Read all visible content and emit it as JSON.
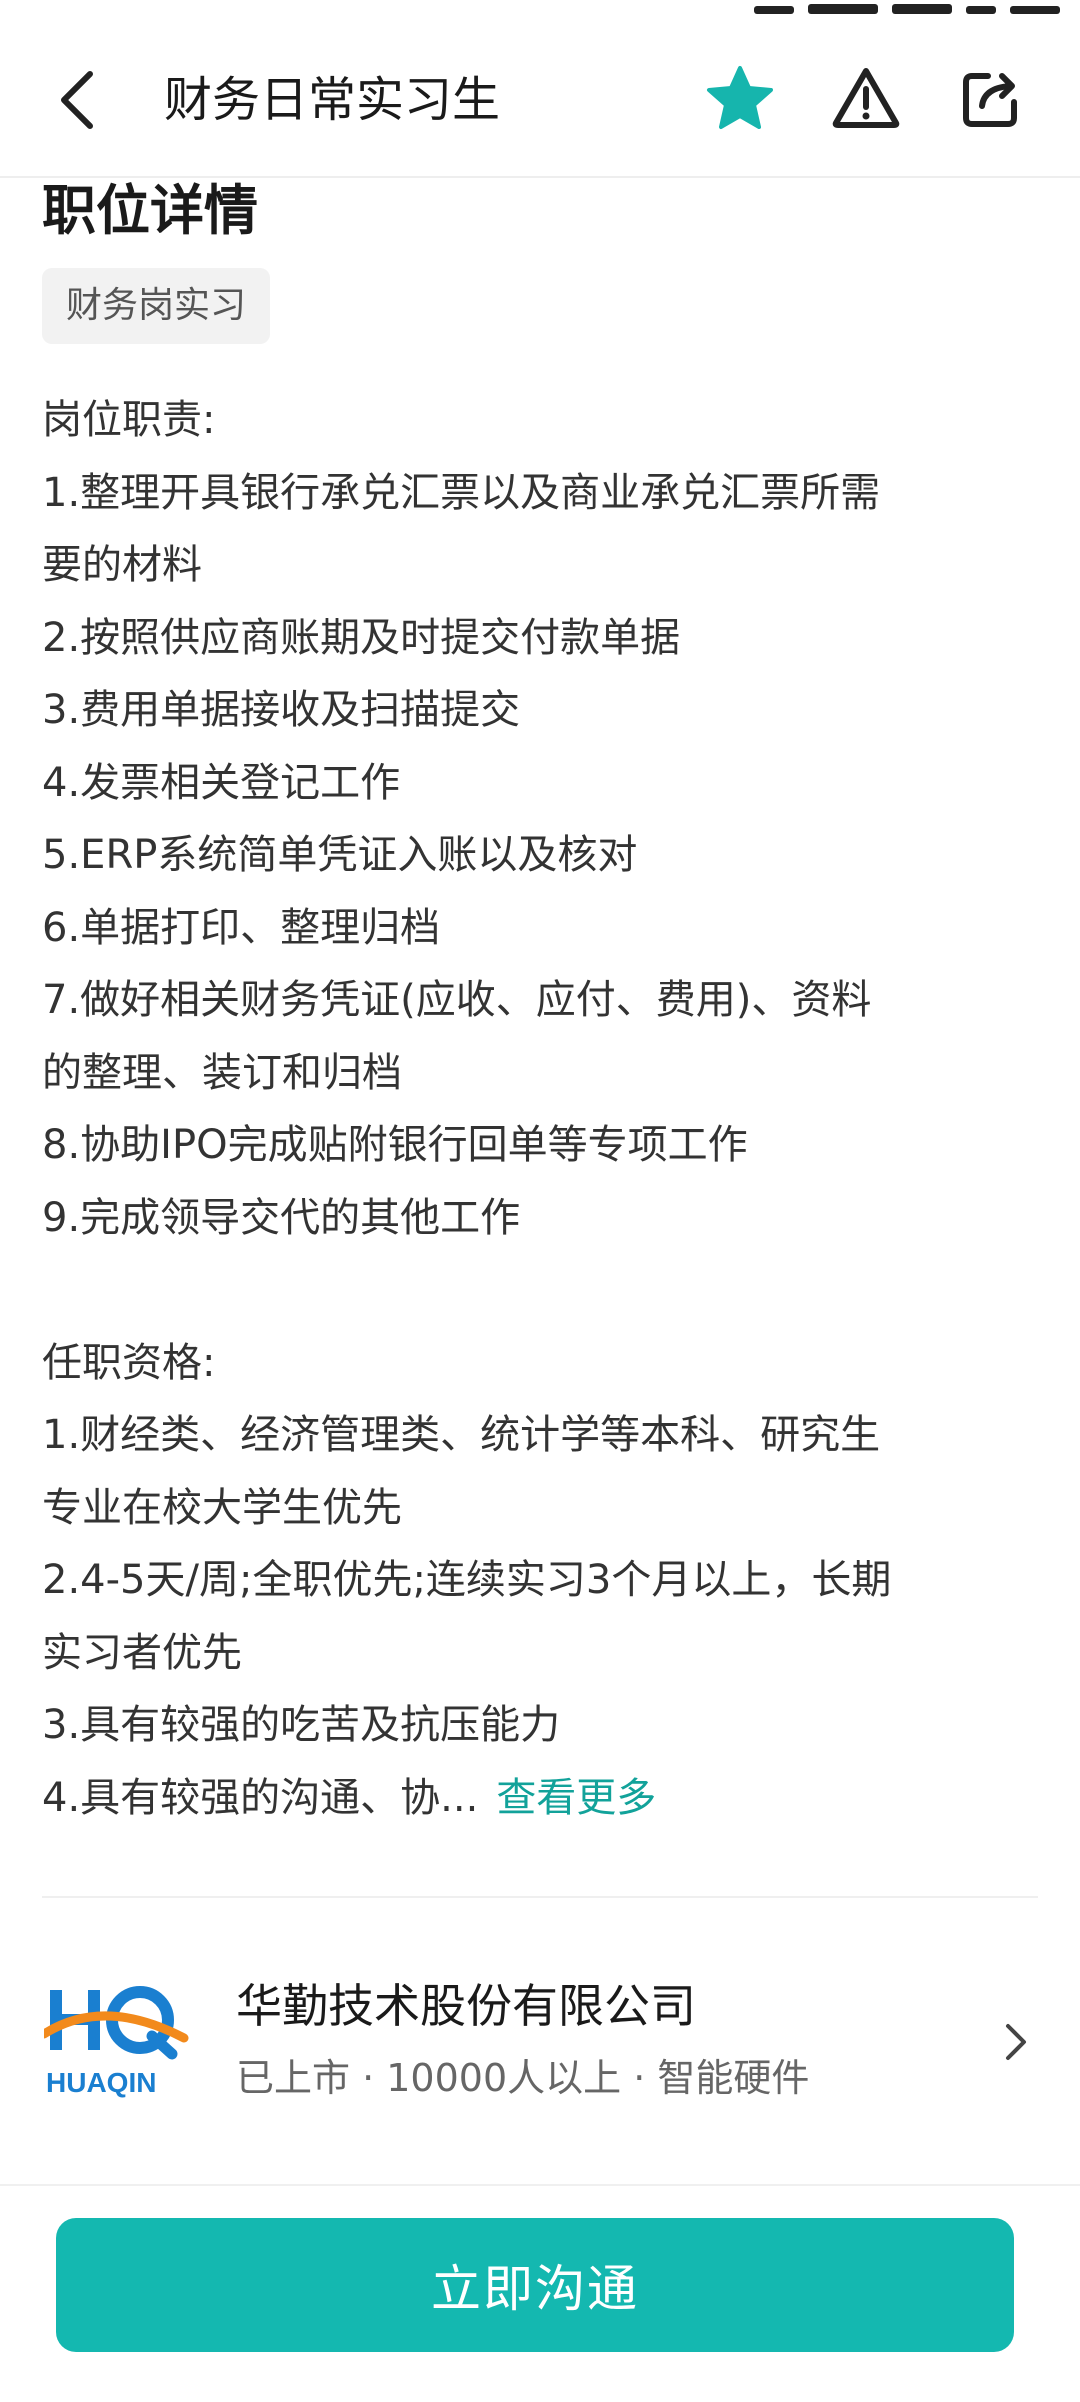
{
  "header": {
    "title": "财务日常实习生",
    "back_icon": "back-arrow-icon",
    "favorite_icon": "star-icon",
    "report_icon": "warning-icon",
    "share_icon": "share-icon"
  },
  "colors": {
    "accent": "#14b8b0",
    "link": "#12a29a",
    "star": "#16b5ad"
  },
  "section": {
    "title": "职位详情",
    "tag": "财务岗实习"
  },
  "description": {
    "lines": [
      "岗位职责:",
      "1.整理开具银行承兑汇票以及商业承兑汇票所需",
      "要的材料",
      "2.按照供应商账期及时提交付款单据",
      "3.费用单据接收及扫描提交",
      "4.发票相关登记工作",
      "5.ERP系统简单凭证入账以及核对",
      "6.单据打印、整理归档",
      "7.做好相关财务凭证(应收、应付、费用)、资料",
      "的整理、装订和归档",
      "8.协助IPO完成贴附银行回单等专项工作",
      "9.完成领导交代的其他工作",
      "",
      "任职资格:",
      "1.财经类、经济管理类、统计学等本科、研究生",
      "专业在校大学生优先",
      "2.4-5天/周;全职优先;连续实习3个月以上，长期",
      "实习者优先",
      "3.具有较强的吃苦及抗压能力"
    ],
    "truncated_line": "4.具有较强的沟通、协...",
    "see_more": "查看更多"
  },
  "company": {
    "name": "华勤技术股份有限公司",
    "meta": "已上市 · 10000人以上 · 智能硬件",
    "logo_text": "HUAQIN",
    "chevron_icon": "chevron-right-icon"
  },
  "actions": {
    "chat_label": "立即沟通"
  }
}
